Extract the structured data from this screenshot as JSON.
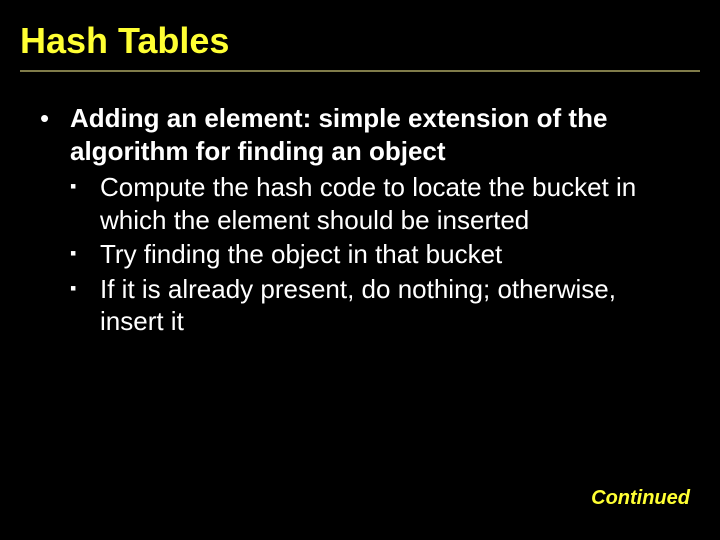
{
  "title": "Hash Tables",
  "main_point": "Adding an element: simple extension of the algorithm for finding an object",
  "sub_points": [
    "Compute the hash code to locate the bucket in which the element should be inserted",
    "Try finding the object in that bucket",
    "If it is already present, do nothing; otherwise, insert it"
  ],
  "footer": "Continued",
  "bullets": {
    "level1": "•",
    "level2": "▪"
  }
}
